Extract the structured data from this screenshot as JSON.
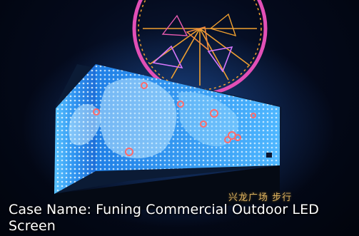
{
  "caption": {
    "text": "Case Name: Funing Commercial Outdoor LED Screen"
  },
  "sign": {
    "text": "兴龙广场 步行"
  },
  "colors": {
    "sky": "#040a1c",
    "screen_blue": "#1e7be8",
    "screen_light": "#7fd0ff",
    "ferris_orange": "#f0a030",
    "ferris_magenta": "#e040c0",
    "dots_red": "#ff5a5a"
  }
}
